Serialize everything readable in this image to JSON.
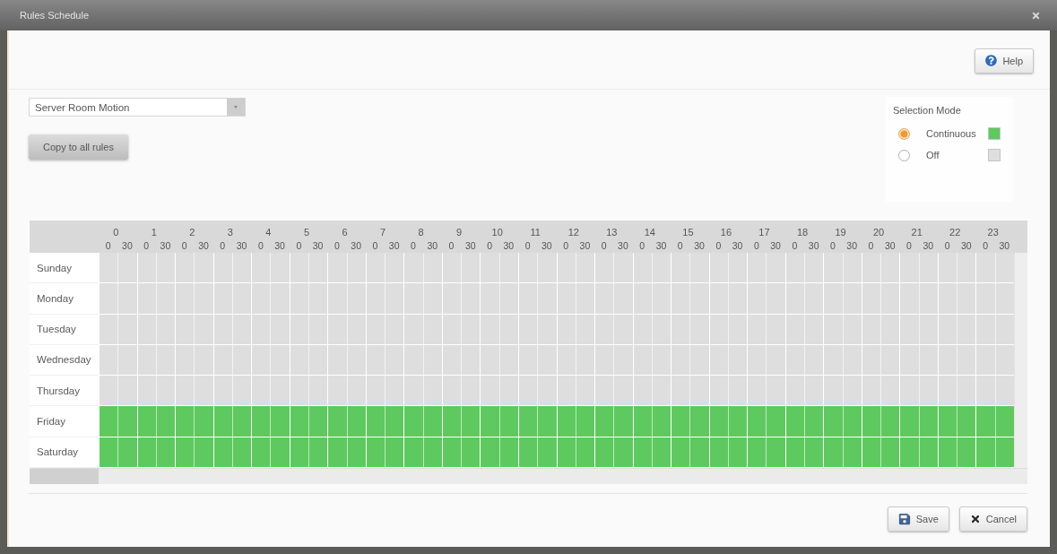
{
  "window": {
    "title": "Rules Schedule"
  },
  "toolbar": {
    "help_button": "Help"
  },
  "rule_select": {
    "value": "Server Room Motion"
  },
  "copy_button": "Copy to all rules",
  "selection_mode": {
    "title": "Selection Mode",
    "options": [
      {
        "kind": "continuous",
        "label": "Continuous",
        "selected": true,
        "color": "#5ec95e"
      },
      {
        "kind": "off",
        "label": "Off",
        "selected": false,
        "color": "#dedede"
      }
    ]
  },
  "schedule": {
    "hours": [
      {
        "label": "0",
        "minutes": [
          "0",
          "30"
        ]
      },
      {
        "label": "1",
        "minutes": [
          "0",
          "30"
        ]
      },
      {
        "label": "2",
        "minutes": [
          "0",
          "30"
        ]
      },
      {
        "label": "3",
        "minutes": [
          "0",
          "30"
        ]
      },
      {
        "label": "4",
        "minutes": [
          "0",
          "30"
        ]
      },
      {
        "label": "5",
        "minutes": [
          "0",
          "30"
        ]
      },
      {
        "label": "6",
        "minutes": [
          "0",
          "30"
        ]
      },
      {
        "label": "7",
        "minutes": [
          "0",
          "30"
        ]
      },
      {
        "label": "8",
        "minutes": [
          "0",
          "30"
        ]
      },
      {
        "label": "9",
        "minutes": [
          "0",
          "30"
        ]
      },
      {
        "label": "10",
        "minutes": [
          "0",
          "30"
        ]
      },
      {
        "label": "11",
        "minutes": [
          "0",
          "30"
        ]
      },
      {
        "label": "12",
        "minutes": [
          "0",
          "30"
        ]
      },
      {
        "label": "13",
        "minutes": [
          "0",
          "30"
        ]
      },
      {
        "label": "14",
        "minutes": [
          "0",
          "30"
        ]
      },
      {
        "label": "15",
        "minutes": [
          "0",
          "30"
        ]
      },
      {
        "label": "16",
        "minutes": [
          "0",
          "30"
        ]
      },
      {
        "label": "17",
        "minutes": [
          "0",
          "30"
        ]
      },
      {
        "label": "18",
        "minutes": [
          "0",
          "30"
        ]
      },
      {
        "label": "19",
        "minutes": [
          "0",
          "30"
        ]
      },
      {
        "label": "20",
        "minutes": [
          "0",
          "30"
        ]
      },
      {
        "label": "21",
        "minutes": [
          "0",
          "30"
        ]
      },
      {
        "label": "22",
        "minutes": [
          "0",
          "30"
        ]
      },
      {
        "label": "23",
        "minutes": [
          "0",
          "30"
        ]
      }
    ],
    "days": [
      {
        "name": "Sunday",
        "slots": [
          false,
          false,
          false,
          false,
          false,
          false,
          false,
          false,
          false,
          false,
          false,
          false,
          false,
          false,
          false,
          false,
          false,
          false,
          false,
          false,
          false,
          false,
          false,
          false,
          false,
          false,
          false,
          false,
          false,
          false,
          false,
          false,
          false,
          false,
          false,
          false,
          false,
          false,
          false,
          false,
          false,
          false,
          false,
          false,
          false,
          false,
          false,
          false
        ]
      },
      {
        "name": "Monday",
        "slots": [
          false,
          false,
          false,
          false,
          false,
          false,
          false,
          false,
          false,
          false,
          false,
          false,
          false,
          false,
          false,
          false,
          false,
          false,
          false,
          false,
          false,
          false,
          false,
          false,
          false,
          false,
          false,
          false,
          false,
          false,
          false,
          false,
          false,
          false,
          false,
          false,
          false,
          false,
          false,
          false,
          false,
          false,
          false,
          false,
          false,
          false,
          false,
          false
        ]
      },
      {
        "name": "Tuesday",
        "slots": [
          false,
          false,
          false,
          false,
          false,
          false,
          false,
          false,
          false,
          false,
          false,
          false,
          false,
          false,
          false,
          false,
          false,
          false,
          false,
          false,
          false,
          false,
          false,
          false,
          false,
          false,
          false,
          false,
          false,
          false,
          false,
          false,
          false,
          false,
          false,
          false,
          false,
          false,
          false,
          false,
          false,
          false,
          false,
          false,
          false,
          false,
          false,
          false
        ]
      },
      {
        "name": "Wednesday",
        "slots": [
          false,
          false,
          false,
          false,
          false,
          false,
          false,
          false,
          false,
          false,
          false,
          false,
          false,
          false,
          false,
          false,
          false,
          false,
          false,
          false,
          false,
          false,
          false,
          false,
          false,
          false,
          false,
          false,
          false,
          false,
          false,
          false,
          false,
          false,
          false,
          false,
          false,
          false,
          false,
          false,
          false,
          false,
          false,
          false,
          false,
          false,
          false,
          false
        ]
      },
      {
        "name": "Thursday",
        "slots": [
          false,
          false,
          false,
          false,
          false,
          false,
          false,
          false,
          false,
          false,
          false,
          false,
          false,
          false,
          false,
          false,
          false,
          false,
          false,
          false,
          false,
          false,
          false,
          false,
          false,
          false,
          false,
          false,
          false,
          false,
          false,
          false,
          false,
          false,
          false,
          false,
          false,
          false,
          false,
          false,
          false,
          false,
          false,
          false,
          false,
          false,
          false,
          false
        ]
      },
      {
        "name": "Friday",
        "slots": [
          true,
          true,
          true,
          true,
          true,
          true,
          true,
          true,
          true,
          true,
          true,
          true,
          true,
          true,
          true,
          true,
          true,
          true,
          true,
          true,
          true,
          true,
          true,
          true,
          true,
          true,
          true,
          true,
          true,
          true,
          true,
          true,
          true,
          true,
          true,
          true,
          true,
          true,
          true,
          true,
          true,
          true,
          true,
          true,
          true,
          true,
          true,
          true
        ]
      },
      {
        "name": "Saturday",
        "slots": [
          true,
          true,
          true,
          true,
          true,
          true,
          true,
          true,
          true,
          true,
          true,
          true,
          true,
          true,
          true,
          true,
          true,
          true,
          true,
          true,
          true,
          true,
          true,
          true,
          true,
          true,
          true,
          true,
          true,
          true,
          true,
          true,
          true,
          true,
          true,
          true,
          true,
          true,
          true,
          true,
          true,
          true,
          true,
          true,
          true,
          true,
          true,
          true
        ]
      }
    ]
  },
  "footer": {
    "save_button": "Save",
    "cancel_button": "Cancel"
  }
}
